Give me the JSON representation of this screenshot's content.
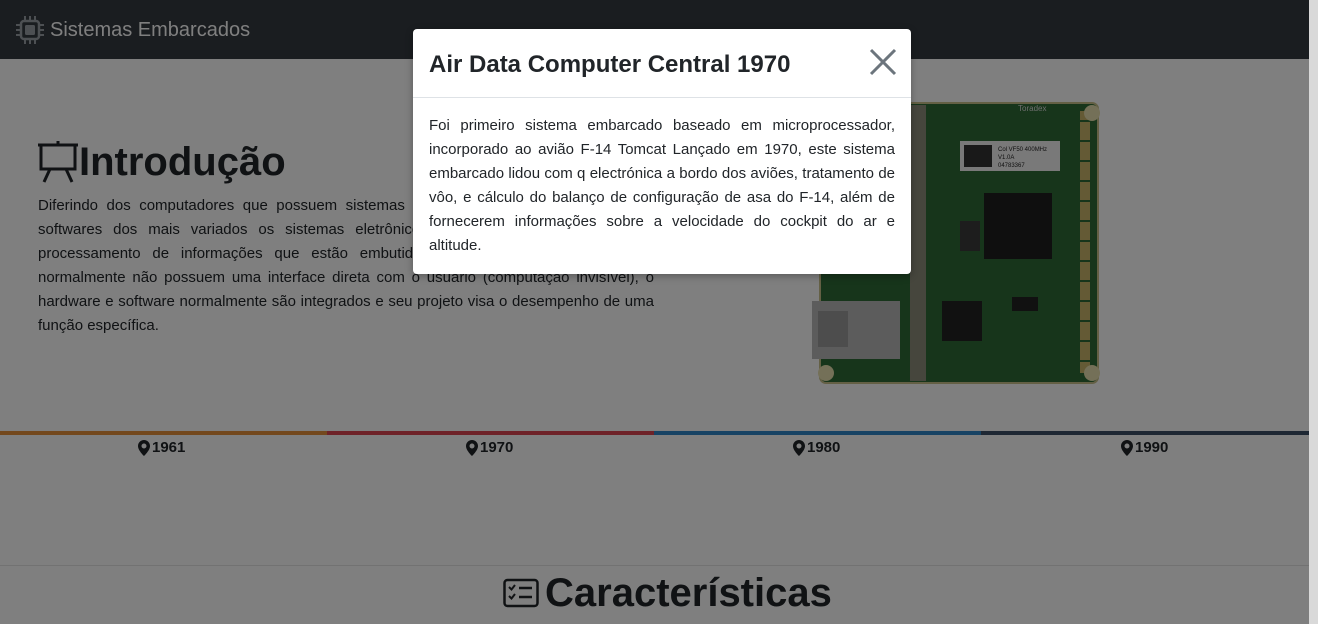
{
  "navbar": {
    "brand": "Sistemas Embarcados",
    "brand_icon": "cpu-chip-icon"
  },
  "intro": {
    "title": "Introdução",
    "title_icon": "presentation-board-icon",
    "text": "Diferindo dos computadores que possuem sistemas operacionais capazes de executar softwares dos mais variados os sistemas eletrônicos embarcados são sistemas de processamento de informações que estão embutidos em produtos maiores e que normalmente não possuem uma interface direta com o usuário (computação invisível), o hardware e software normalmente são integrados e seu projeto visa o desempenho de uma função específica."
  },
  "board_image": {
    "icon": "embedded-board-image",
    "brand_label": "Toradex",
    "chip_label_1": "Col VF50 400MHz",
    "chip_label_2": "V1.0A",
    "chip_label_3": "04783367"
  },
  "timeline": {
    "items": [
      {
        "label": "1961",
        "color": "#e6913a"
      },
      {
        "label": "1970",
        "color": "#dd4450"
      },
      {
        "label": "1980",
        "color": "#2e86c9"
      },
      {
        "label": "1990",
        "color": "#3d4e66"
      }
    ]
  },
  "features": {
    "title": "Características",
    "title_icon": "checklist-icon"
  },
  "modal": {
    "title": "Air Data Computer Central 1970",
    "close_icon": "close-icon",
    "body": "Foi primeiro sistema embarcado baseado em microprocessador, incorporado ao avião F-14 Tomcat Lançado em 1970, este sistema embarcado lidou com q electrónica a bordo dos aviões, tratamento de vôo, e cálculo do balanço de configuração de asa do F-14, além de fornecerem informações sobre a velocidade do cockpit do ar e altitude."
  }
}
